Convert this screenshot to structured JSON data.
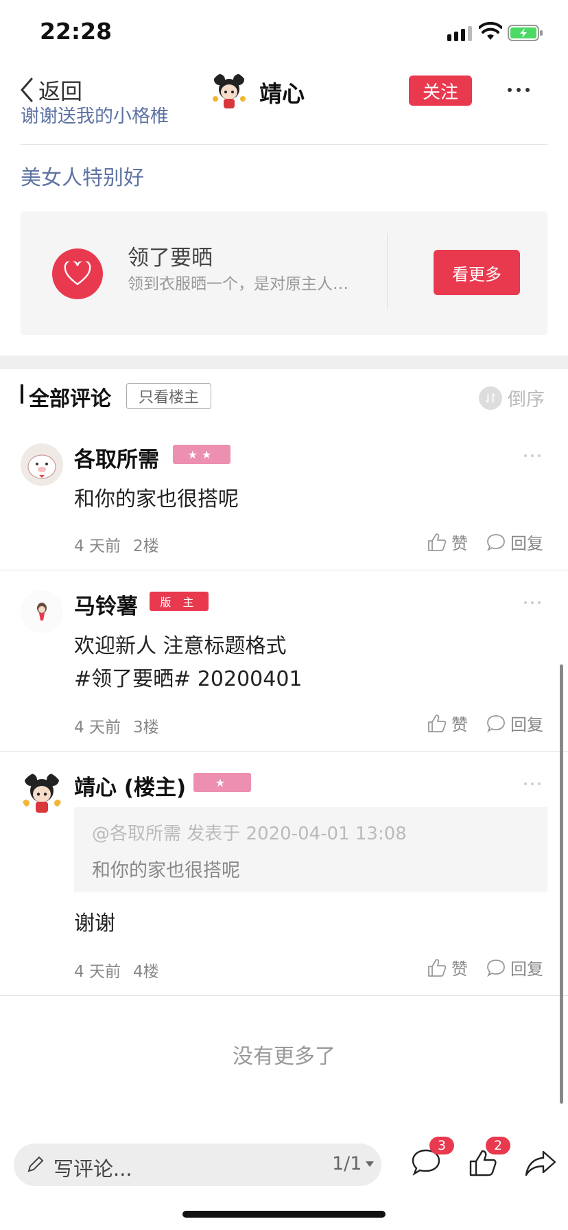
{
  "status": {
    "time": "22:28"
  },
  "nav": {
    "back_label": "返回",
    "name": "靖心",
    "follow_label": "关注"
  },
  "post": {
    "cut_text": "谢谢送我的小格椎",
    "line": "美女人特别好"
  },
  "promo": {
    "title": "领了要晒",
    "desc": "领到衣服晒一个，是对原主人…",
    "button": "看更多"
  },
  "comments_header": {
    "title": "全部评论",
    "only_owner": "只看楼主",
    "sort": "倒序"
  },
  "comments": [
    {
      "name": "各取所需",
      "badge": "★★",
      "text": "和你的家也很搭呢",
      "time": "4 天前",
      "floor": "2楼",
      "like": "赞",
      "reply": "回复"
    },
    {
      "name": "马铃薯",
      "badge": "版 主",
      "text_1": "欢迎新人 注意标题格式",
      "text_2": "#领了要晒# 20200401",
      "time": "4 天前",
      "floor": "3楼",
      "like": "赞",
      "reply": "回复"
    },
    {
      "name": "靖心 (楼主)",
      "badge": "★",
      "quote_header": "@各取所需 发表于 2020-04-01 13:08",
      "quote_text": "和你的家也很搭呢",
      "text": "谢谢",
      "time": "4 天前",
      "floor": "4楼",
      "like": "赞",
      "reply": "回复"
    }
  ],
  "no_more": "没有更多了",
  "bottom": {
    "input_placeholder": "写评论...",
    "page": "1/1",
    "comment_count": "3",
    "like_count": "2"
  },
  "colors": {
    "accent": "#e8394f",
    "link": "#5e73a3",
    "badge_pink": "#ec8fb0"
  }
}
